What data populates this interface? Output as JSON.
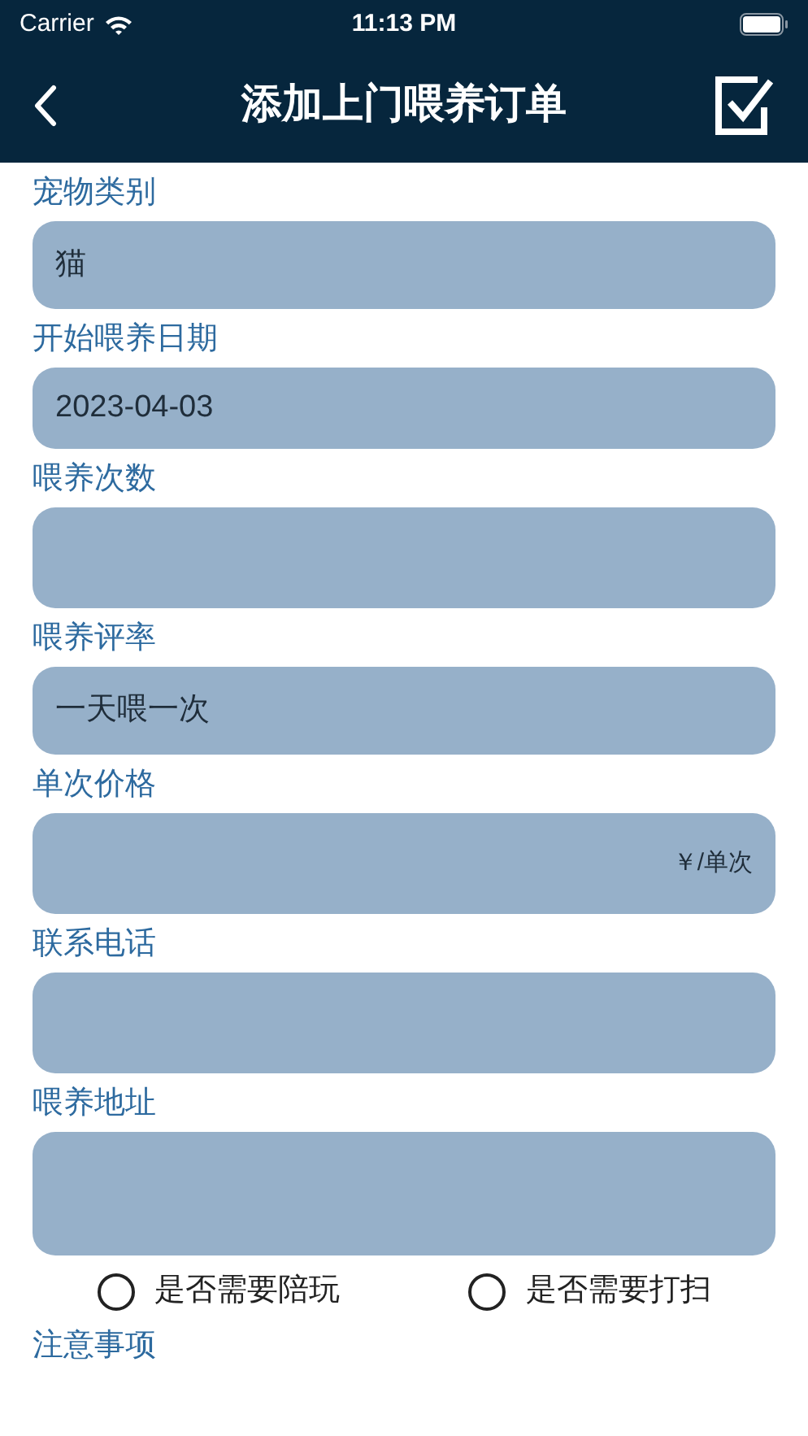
{
  "status_bar": {
    "carrier": "Carrier",
    "time": "11:13 PM"
  },
  "nav": {
    "title": "添加上门喂养订单"
  },
  "fields": [
    {
      "label": "宠物类别",
      "value": "猫"
    },
    {
      "label": "开始喂养日期",
      "value": "2023-04-03"
    },
    {
      "label": "喂养次数"
    },
    {
      "label": "喂养评率",
      "value": "一天喂一次"
    },
    {
      "label": "单次价格",
      "suffix": "￥/单次"
    },
    {
      "label": "联系电话"
    },
    {
      "label": "喂养地址"
    }
  ],
  "options": [
    {
      "label": "是否需要陪玩",
      "checked": false
    },
    {
      "label": "是否需要打扫",
      "checked": false
    }
  ],
  "notes_label": "注意事项"
}
